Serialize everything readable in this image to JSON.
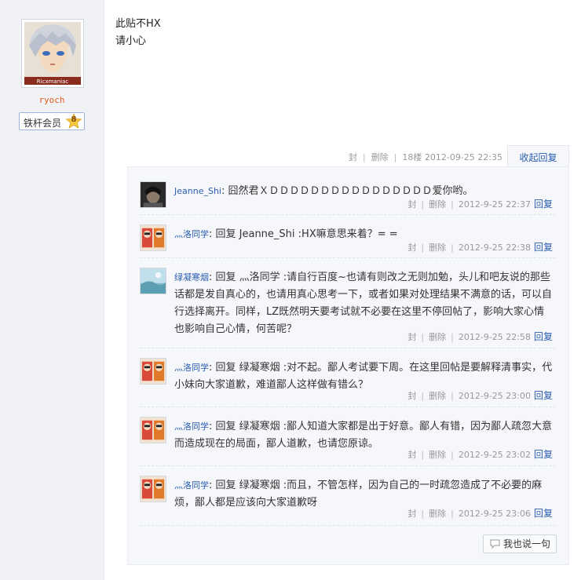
{
  "author": {
    "name": "ryoch",
    "avatar_caption": "Ricxmaniac",
    "level_title": "铁杆会员",
    "level": "8"
  },
  "post": {
    "lines": [
      "此贴不HX",
      "请小心"
    ],
    "meta": {
      "seal": "封",
      "delete": "删除",
      "floor": "18楼",
      "time": "2012-09-25 22:35"
    },
    "collapse_label": "收起回复"
  },
  "replies": [
    {
      "user": "Jeanne_Shi",
      "text": "囧然君ＸＤＤＤＤＤＤＤＤＤＤＤＤＤＤＤＤ爱你哟。",
      "seal": "封",
      "delete": "删除",
      "time": "2012-9-25 22:37",
      "reply": "回复",
      "avatar": "photo-avatar"
    },
    {
      "user": "灬洛同学",
      "text": "回复 Jeanne_Shi :HX嘛意思来着？= =",
      "seal": "封",
      "delete": "删除",
      "time": "2012-9-25 22:38",
      "reply": "回复",
      "avatar": "anime-avatar"
    },
    {
      "user": "绿凝寒烟",
      "text": "回复 灬洛同学 :请自行百度~也请有则改之无则加勉，头儿和吧友说的那些话都是发自真心的，也请用真心思考一下，或者如果对处理结果不满意的话，可以自行选择离开。同样，LZ既然明天要考试就不必要在这里不停回帖了，影响大家心情也影响自己心情，何苦呢？",
      "seal": "封",
      "delete": "删除",
      "time": "2012-9-25 22:58",
      "reply": "回复",
      "avatar": "scenery-avatar"
    },
    {
      "user": "灬洛同学",
      "text": "回复 绿凝寒烟 :对不起。鄙人考试要下周。在这里回帖是要解释清事实，代小妹向大家道歉，难道鄙人这样做有错么？",
      "seal": "封",
      "delete": "删除",
      "time": "2012-9-25 23:00",
      "reply": "回复",
      "avatar": "anime-avatar"
    },
    {
      "user": "灬洛同学",
      "text": "回复 绿凝寒烟 :鄙人知道大家都是出于好意。鄙人有错，因为鄙人疏忽大意而造成现在的局面，鄙人道歉，也请您原谅。",
      "seal": "封",
      "delete": "删除",
      "time": "2012-9-25 23:02",
      "reply": "回复",
      "avatar": "anime-avatar"
    },
    {
      "user": "灬洛同学",
      "text": "回复 绿凝寒烟 :而且，不管怎样，因为自己的一时疏忽造成了不必要的麻烦，鄙人都是应该向大家道歉呀",
      "seal": "封",
      "delete": "删除",
      "time": "2012-9-25 23:06",
      "reply": "回复",
      "avatar": "anime-avatar"
    }
  ],
  "say_button": "我也说一句",
  "colors": {
    "link": "#2a5db0",
    "author_name": "#e05a1a",
    "meta": "#999999",
    "panel_bg": "#f5f7fa",
    "sidebar_bg": "#f0f2f6"
  }
}
